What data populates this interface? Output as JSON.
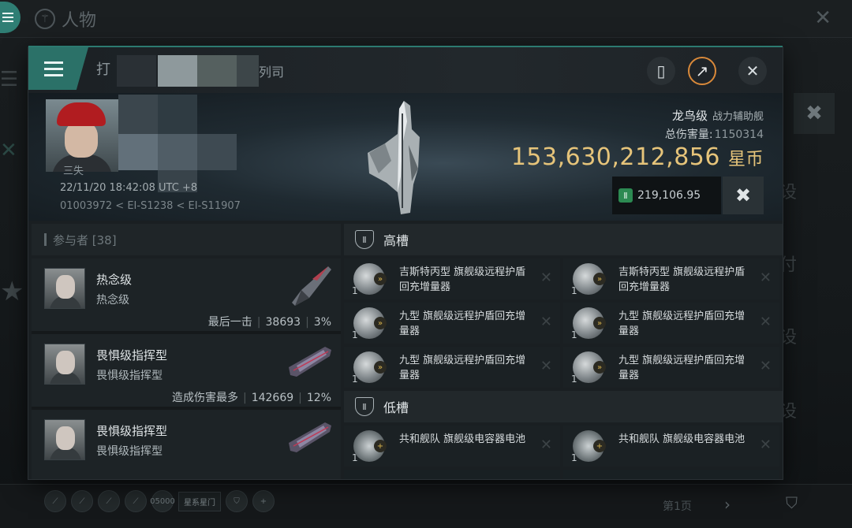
{
  "background": {
    "title": "人物",
    "right_side_chars": [
      "设",
      "付",
      "设",
      "设"
    ],
    "bottom_page_label": "第1页",
    "dock_label": "星系星门",
    "dock_counter": "05000"
  },
  "modal": {
    "title_start": "打",
    "title_end": "列司",
    "victim": {
      "name": "三失",
      "kill_time": "22/11/20 18:42:08 UTC +8",
      "location": "01003972 < EI-S1238 < EI-S11907"
    },
    "ship": {
      "class": "龙鸟级",
      "category": "战力辅助舰",
      "total_damage_label": "总伤害量:",
      "total_damage_value": "1150314",
      "isk_value": "153,630,212,856",
      "isk_unit": "星币",
      "plex_value": "219,106.95",
      "fit_icon": "wrench-hammer-icon"
    },
    "participants": {
      "header": "参与者 [38]",
      "items": [
        {
          "name": "热念级",
          "ship": "热念级",
          "stat_label": "最后一击",
          "damage": "38693",
          "percent": "3%"
        },
        {
          "name": "畏惧级指挥型",
          "ship": "畏惧级指挥型",
          "stat_label": "造成伤害最多",
          "damage": "142669",
          "percent": "12%"
        },
        {
          "name": "畏惧级指挥型",
          "ship": "畏惧级指挥型",
          "stat_label": "",
          "damage": "",
          "percent": ""
        }
      ]
    },
    "high_slots": {
      "label": "高槽",
      "modules": [
        {
          "qty": "1",
          "name": "吉斯特丙型 旗舰级远程护盾回充增量器"
        },
        {
          "qty": "1",
          "name": "吉斯特丙型 旗舰级远程护盾回充增量器"
        },
        {
          "qty": "1",
          "name": "九型 旗舰级远程护盾回充增量器"
        },
        {
          "qty": "1",
          "name": "九型 旗舰级远程护盾回充增量器"
        },
        {
          "qty": "1",
          "name": "九型 旗舰级远程护盾回充增量器"
        },
        {
          "qty": "1",
          "name": "九型 旗舰级远程护盾回充增量器"
        }
      ]
    },
    "low_slots": {
      "label": "低槽",
      "modules": [
        {
          "qty": "1",
          "name": "共和舰队 旗舰级电容器电池"
        },
        {
          "qty": "1",
          "name": "共和舰队 旗舰级电容器电池"
        }
      ]
    }
  },
  "colors": {
    "accent": "#2c7a70",
    "isk_gold": "#e6c47a",
    "plex_green": "#2c8a52",
    "header_orange": "#d9893a"
  }
}
